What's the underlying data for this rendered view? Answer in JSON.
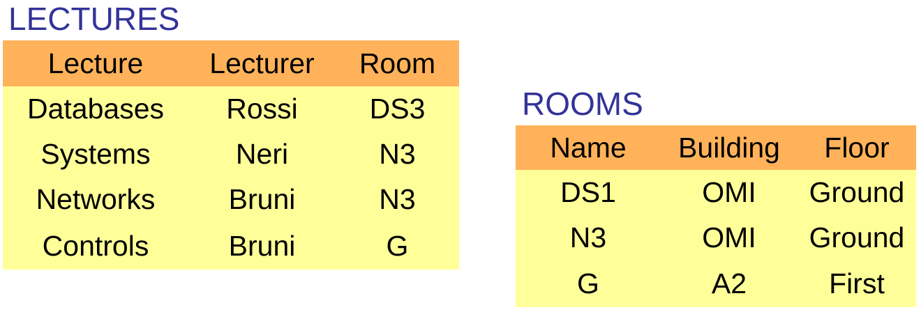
{
  "lectures": {
    "title": "LECTURES",
    "columns": [
      "Lecture",
      "Lecturer",
      "Room"
    ],
    "rows": [
      [
        "Databases",
        "Rossi",
        "DS3"
      ],
      [
        "Systems",
        "Neri",
        "N3"
      ],
      [
        "Networks",
        "Bruni",
        "N3"
      ],
      [
        "Controls",
        "Bruni",
        "G"
      ]
    ]
  },
  "rooms": {
    "title": "ROOMS",
    "columns": [
      "Name",
      "Building",
      "Floor"
    ],
    "rows": [
      [
        "DS1",
        "OMI",
        "Ground"
      ],
      [
        "N3",
        "OMI",
        "Ground"
      ],
      [
        "G",
        "A2",
        "First"
      ]
    ]
  },
  "colors": {
    "title": "#333399",
    "header_bg": "#ffb25a",
    "body_bg": "#ffff99"
  }
}
